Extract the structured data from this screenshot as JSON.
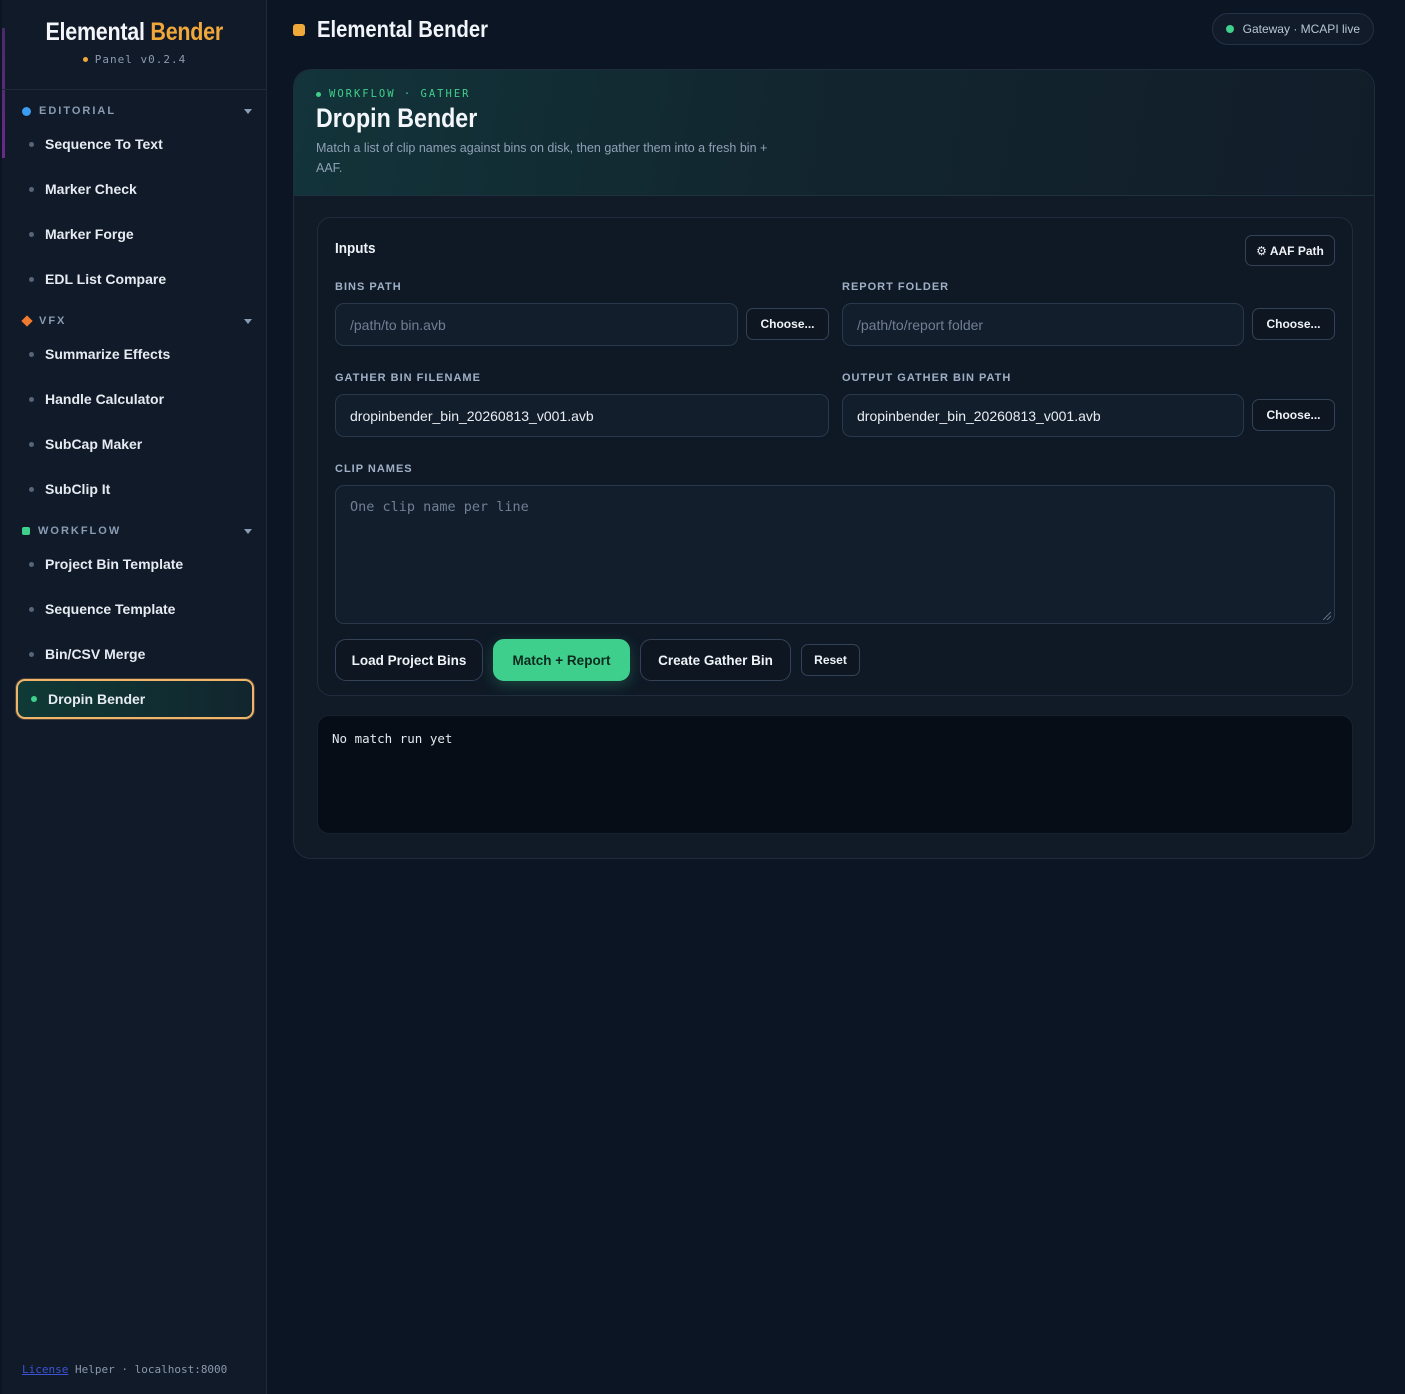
{
  "brand": {
    "title_main": "Elemental",
    "title_accent": "Bender",
    "version": "Panel v0.2.4"
  },
  "sidebar": {
    "groups": [
      {
        "label": "EDITORIAL",
        "icon": "circle-icon",
        "color": "#3b9cf0",
        "items": [
          "Sequence To Text",
          "Marker Check",
          "Marker Forge",
          "EDL List Compare"
        ]
      },
      {
        "label": "VFX",
        "icon": "diamond-icon",
        "color": "#f07a30",
        "items": [
          "Summarize Effects",
          "Handle Calculator",
          "SubCap Maker",
          "SubClip It"
        ]
      },
      {
        "label": "WORKFLOW",
        "icon": "square-icon",
        "color": "#3fd08b",
        "items": [
          "Project Bin Template",
          "Sequence Template",
          "Bin/CSV Merge",
          "Dropin Bender"
        ]
      }
    ],
    "active_item": "Dropin Bender",
    "footer": {
      "link": "License",
      "text": "Helper · localhost:8000"
    }
  },
  "header": {
    "title": "Elemental Bender",
    "status": "Gateway · MCAPI live"
  },
  "tool": {
    "eyebrow": "WORKFLOW · GATHER",
    "title": "Dropin Bender",
    "description": "Match a list of clip names against bins on disk, then gather them into a fresh bin + AAF."
  },
  "inputs": {
    "title": "Inputs",
    "aaf_button": "⚙ AAF Path",
    "bins_path": {
      "label": "BINS PATH",
      "value": "",
      "placeholder": "/path/to bin.avb",
      "button": "Choose..."
    },
    "report_folder": {
      "label": "REPORT FOLDER",
      "value": "",
      "placeholder": "/path/to/report folder",
      "button": "Choose..."
    },
    "gather_bin_filename": {
      "label": "GATHER BIN FILENAME",
      "value": "dropinbender_bin_20260813_v001.avb"
    },
    "output_gather_bin_path": {
      "label": "OUTPUT GATHER BIN PATH",
      "value": "dropinbender_bin_20260813_v001.avb",
      "button": "Choose..."
    },
    "clip_names": {
      "label": "CLIP NAMES",
      "placeholder": "One clip name per line"
    }
  },
  "actions": {
    "load": "Load Project Bins",
    "match": "Match + Report",
    "create": "Create Gather Bin",
    "reset": "Reset"
  },
  "output": {
    "text": "No match run yet"
  },
  "colors": {
    "accent": "#f0a83a",
    "success": "#3fcf8c",
    "background": "#0c1524"
  }
}
